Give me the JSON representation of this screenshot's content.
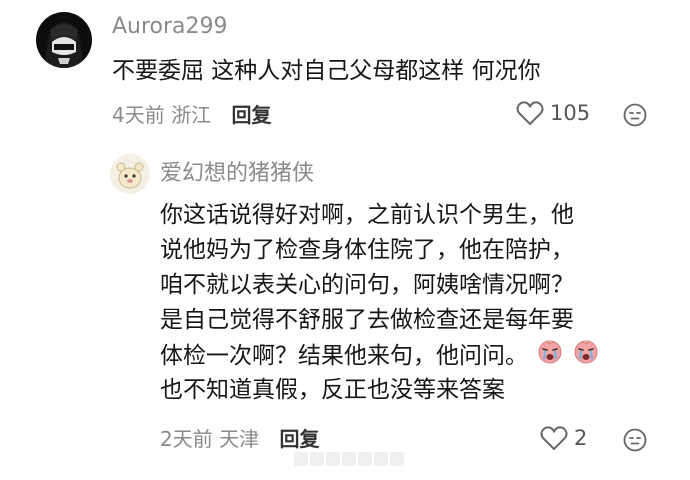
{
  "comments": [
    {
      "username": "Aurora299",
      "text": "不要委屈 这种人对自己父母都这样 何况你",
      "time": "4天前",
      "location": "浙江",
      "reply_label": "回复",
      "likes": "105",
      "avatar_icon": "anime-girl-avatar-icon"
    },
    {
      "username": "爱幻想的猪猪侠",
      "lines": [
        "你这话说得好对啊，之前认识个男生，他",
        "说他妈为了检查身体住院了，他在陪护，",
        "咱不就以表关心的问句，阿姨啥情况啊？",
        "是自己觉得不舒服了去做检查还是每年要",
        "体检一次啊？结果他来句，他问问。",
        "也不知道真假，反正也没等来答案"
      ],
      "time": "2天前",
      "location": "天津",
      "reply_label": "回复",
      "likes": "2",
      "avatar_icon": "cartoon-bear-avatar-icon",
      "inline_emoji": "crying-emoji-icon"
    }
  ],
  "colors": {
    "meta_gray": "#8a8a8a",
    "text": "#161616",
    "emoji_pink": "#f29a9a"
  }
}
